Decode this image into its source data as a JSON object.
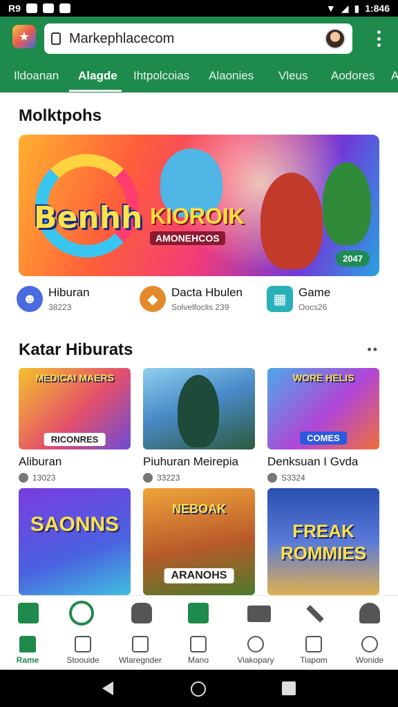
{
  "status_bar": {
    "left_icons": [
      "R9",
      "M",
      "V",
      "D"
    ],
    "time": "1:846"
  },
  "app_bar": {
    "url": "Markephlacecom",
    "tabs": [
      "Ildoanan",
      "Alagde",
      "Ihtpolcoias",
      "Alaonies",
      "Vleus",
      "Aodores",
      "A"
    ],
    "active_tab": 1
  },
  "section1": {
    "title": "Molktpohs"
  },
  "hero": {
    "logo_left": "Benhh",
    "logo_mid": "KIOROIK",
    "logo_sub": "AMONEHCOS",
    "badge": "2047"
  },
  "categories": [
    {
      "name": "Hiburan",
      "sub": "38223",
      "icon": "smiley-icon",
      "color": "#4a6be0"
    },
    {
      "name": "Dacta Hbulen",
      "sub": "Solvelfoclis 239",
      "icon": "football-icon",
      "color": "#e28a2b"
    },
    {
      "name": "Game",
      "sub": "Oocs26",
      "icon": "gamepad-icon",
      "color": "#2ab0b8"
    }
  ],
  "section2": {
    "title": "Katar Hiburats",
    "more": "••"
  },
  "cards": [
    {
      "title": "Aliburan",
      "meta": "13023",
      "art_label": "MEDICAI MAERS",
      "art_tag": "RICONRES",
      "bg": "linear-gradient(135deg,#f5c12b,#e4506a 55%,#6b4bd6)"
    },
    {
      "title": "Piuhuran Meirepia",
      "meta": "33223",
      "art_label": "",
      "art_tag": "",
      "bg": "linear-gradient(160deg,#8fd0f0,#4a8ac9 45%,#2b5a3c)"
    },
    {
      "title": "Denksuan I Gvda",
      "meta": "S3324",
      "art_label": "WORE HELIS",
      "art_tag": "COMES",
      "bg": "linear-gradient(135deg,#4ea8e8,#b046d8 55%,#f0703a)"
    },
    {
      "title": "",
      "meta": "",
      "art_label": "SAONNS",
      "art_tag": "",
      "bg": "linear-gradient(160deg,#7a3ce0,#4a62e0 60%,#40c0e0)"
    },
    {
      "title": "",
      "meta": "",
      "art_label": "NEBOAK",
      "art_tag": "ARANOHS",
      "bg": "linear-gradient(170deg,#f0a43a,#b85a2a 55%,#4b7a2a)"
    },
    {
      "title": "",
      "meta": "",
      "art_label": "FREAK ROMMIES",
      "art_tag": "",
      "bg": "linear-gradient(180deg,#2a4fb0,#5a7ad8 50%,#e0b050)"
    }
  ],
  "bottom_nav": {
    "top_icons": [
      "grid-icon",
      "shield-icon",
      "gamepad-icon",
      "mail-icon",
      "truck-icon",
      "tools-icon",
      "person-icon"
    ],
    "items": [
      {
        "label": "Rame",
        "icon": "home-icon"
      },
      {
        "label": "Stoouide",
        "icon": "chat-icon"
      },
      {
        "label": "Wlaregnder",
        "icon": "document-icon"
      },
      {
        "label": "Mano",
        "icon": "face-icon"
      },
      {
        "label": "Viakopary",
        "icon": "clock-icon"
      },
      {
        "label": "Tiapom",
        "icon": "checkbox-icon"
      },
      {
        "label": "Wonide",
        "icon": "user-icon"
      }
    ],
    "active_item": 0
  },
  "colors": {
    "brand": "#1e8a4c",
    "text": "#111111"
  }
}
